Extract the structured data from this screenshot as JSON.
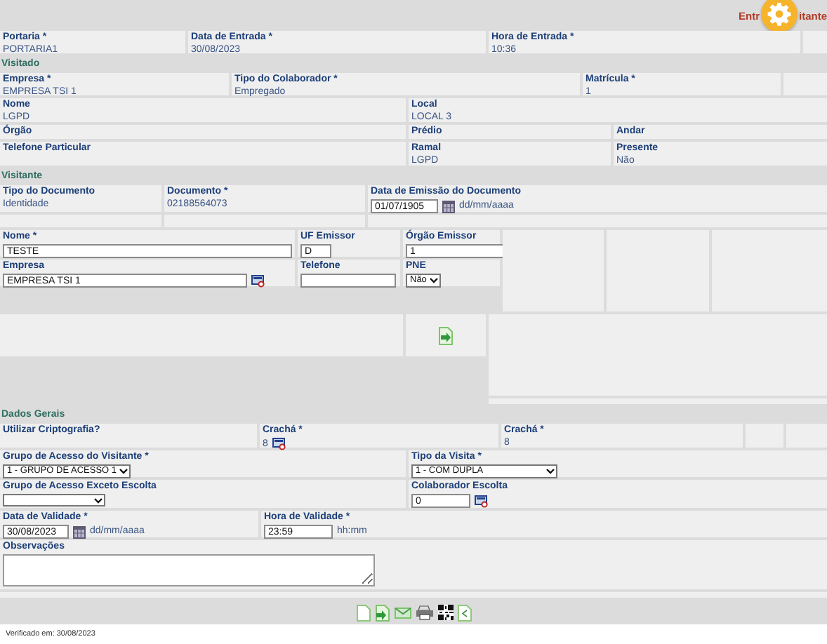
{
  "header": {
    "title_start": "Entr",
    "title_end": "itante"
  },
  "entry": [
    {
      "kind": "text",
      "label": "Portaria *",
      "value": "PORTARIA1"
    },
    {
      "kind": "text",
      "label": "Data de Entrada *",
      "value": "30/08/2023"
    },
    {
      "kind": "text",
      "label": "Hora de Entrada *",
      "value": "10:36"
    }
  ],
  "visitado": {
    "title": "Visitado",
    "rows": [
      [
        {
          "kind": "text",
          "label": "Empresa *",
          "value": "EMPRESA TSI 1"
        },
        {
          "kind": "text",
          "label": "Tipo do Colaborador *",
          "value": "Empregado"
        },
        {
          "kind": "text",
          "label": "Matrícula *",
          "value": "1"
        }
      ],
      [
        {
          "kind": "text",
          "label": "Nome",
          "value": "LGPD"
        },
        {
          "kind": "text",
          "label": "Local",
          "value": "LOCAL 3"
        }
      ],
      [
        {
          "kind": "text",
          "label": "Órgão"
        },
        {
          "kind": "text",
          "label": "Prédio"
        },
        {
          "kind": "text",
          "label": "Andar"
        }
      ],
      [
        {
          "kind": "text",
          "label": "Telefone Particular"
        },
        {
          "kind": "text",
          "label": "Ramal",
          "value": "LGPD"
        },
        {
          "kind": "text",
          "label": "Presente",
          "value": "Não"
        }
      ]
    ]
  },
  "visitante": {
    "title": "Visitante",
    "document": [
      {
        "kind": "text",
        "label": "Tipo do Documento",
        "value": "Identidade"
      },
      {
        "kind": "text",
        "label": "Documento *",
        "value": "02188564073"
      },
      {
        "kind": "date",
        "label": "Data de Emissão do Documento",
        "value": "01/07/1905",
        "hint": "dd/mm/aaaa"
      }
    ],
    "form": [
      {
        "kind": "input",
        "label": "Nome *",
        "value": "TESTE"
      },
      {
        "kind": "input",
        "label": "UF Emissor",
        "value": "D"
      },
      {
        "kind": "input",
        "label": "Órgão Emissor",
        "value": "1"
      },
      {
        "kind": "lookup",
        "label": "Empresa",
        "value": "EMPRESA TSI 1"
      },
      {
        "kind": "input",
        "label": "Telefone"
      },
      {
        "kind": "select",
        "label": "PNE",
        "value": "Não"
      }
    ]
  },
  "dados_gerais": {
    "title": "Dados Gerais",
    "rows": [
      [
        {
          "kind": "text",
          "label": "Utilizar Criptografia?"
        },
        {
          "kind": "code",
          "label": "Crachá *",
          "value": "8"
        },
        {
          "kind": "text",
          "label": "Crachá *",
          "value": "8"
        }
      ],
      [
        {
          "kind": "select",
          "label": "Grupo de Acesso do Visitante *",
          "value": "1 - GRUPO DE ACESSO 1"
        },
        {
          "kind": "select",
          "label": "Tipo da Visita *",
          "value": "1 - COM DUPLA"
        }
      ],
      [
        {
          "kind": "select",
          "label": "Grupo de Acesso Exceto Escolta"
        },
        {
          "kind": "lookup",
          "label": "Colaborador Escolta",
          "value": "0"
        }
      ],
      [
        {
          "kind": "date",
          "label": "Data de Validade *",
          "value": "30/08/2023",
          "hint": "dd/mm/aaaa"
        },
        {
          "kind": "time",
          "label": "Hora de Validade *",
          "value": "23:59",
          "hint": "hh:mm"
        }
      ],
      [
        {
          "kind": "textarea",
          "label": "Observações"
        }
      ]
    ]
  },
  "footer": "Verificado em: 30/08/2023"
}
